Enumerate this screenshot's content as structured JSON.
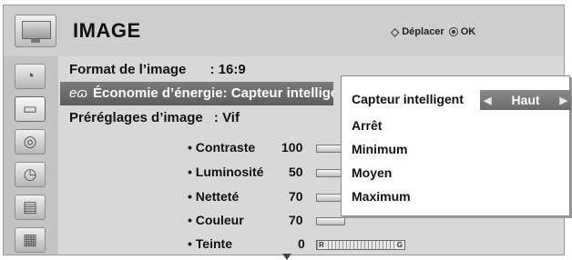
{
  "header": {
    "title": "IMAGE",
    "hint_move_label": "Déplacer",
    "hint_ok_label": "OK",
    "icon": "tv-icon"
  },
  "sidebar": {
    "items": [
      {
        "icon": "satellite-dish-icon"
      },
      {
        "icon": "tv-picture-icon"
      },
      {
        "icon": "speaker-icon"
      },
      {
        "icon": "clock-icon"
      },
      {
        "icon": "options-icon"
      },
      {
        "icon": "clapperboard-icon"
      }
    ]
  },
  "menu": {
    "aspect_ratio": {
      "label": "Format de l’image",
      "value": ": 16:9"
    },
    "energy_saving": {
      "label": "Économie d’énergie: Capteur intelligent"
    },
    "picture_mode": {
      "label": "Préréglages d’image",
      "value": ": Vif"
    },
    "settings": [
      {
        "label": "• Contraste",
        "value": "100",
        "level": 1.0
      },
      {
        "label": "• Luminosité",
        "value": "50",
        "level": 0.5
      },
      {
        "label": "• Netteté",
        "value": "70",
        "level": 0.7
      },
      {
        "label": "• Couleur",
        "value": "70",
        "level": 0.7
      },
      {
        "label": "• Teinte",
        "value": "0",
        "r_label": "R",
        "g_label": "G"
      }
    ]
  },
  "popup": {
    "selected_label": "Capteur intelligent",
    "selected_value": "Haut",
    "options": [
      "Arrêt",
      "Minimum",
      "Moyen",
      "Maximum"
    ]
  },
  "colors": {
    "highlight": "#6b6b6b",
    "panel": "#d8d8d8",
    "popup_bg": "#ffffff"
  }
}
